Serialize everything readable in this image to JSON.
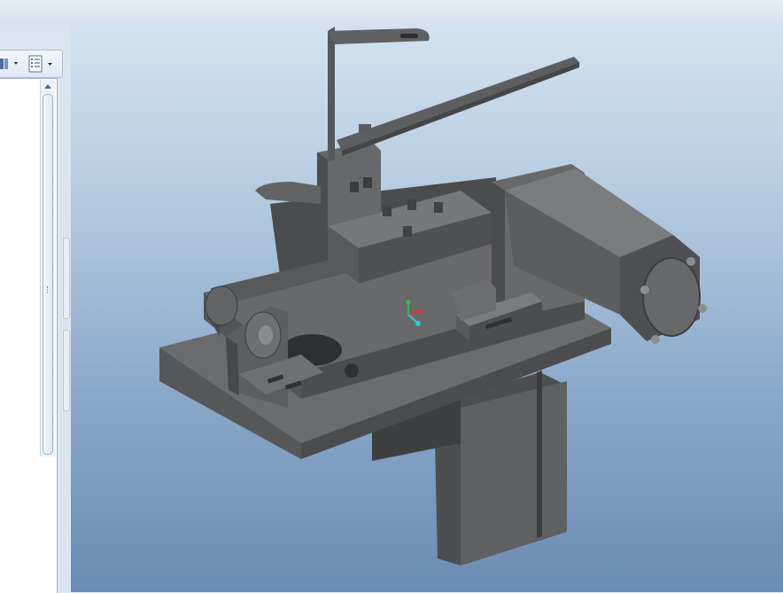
{
  "window": {
    "toolbar": {
      "buttons": [
        {
          "icon": "model-tree-filter-icon",
          "has_dropdown": true
        },
        {
          "icon": "tree-settings-icon",
          "has_dropdown": true
        }
      ]
    },
    "model_tree": {
      "items": []
    },
    "viewport": {
      "background_top": "#d3e2f0",
      "background_bottom": "#6a8bb3",
      "model_color": "#555759",
      "triad": {
        "x_color": "#e0333a",
        "y_color": "#2fbf3a",
        "z_color": "#30c8e0"
      }
    }
  }
}
